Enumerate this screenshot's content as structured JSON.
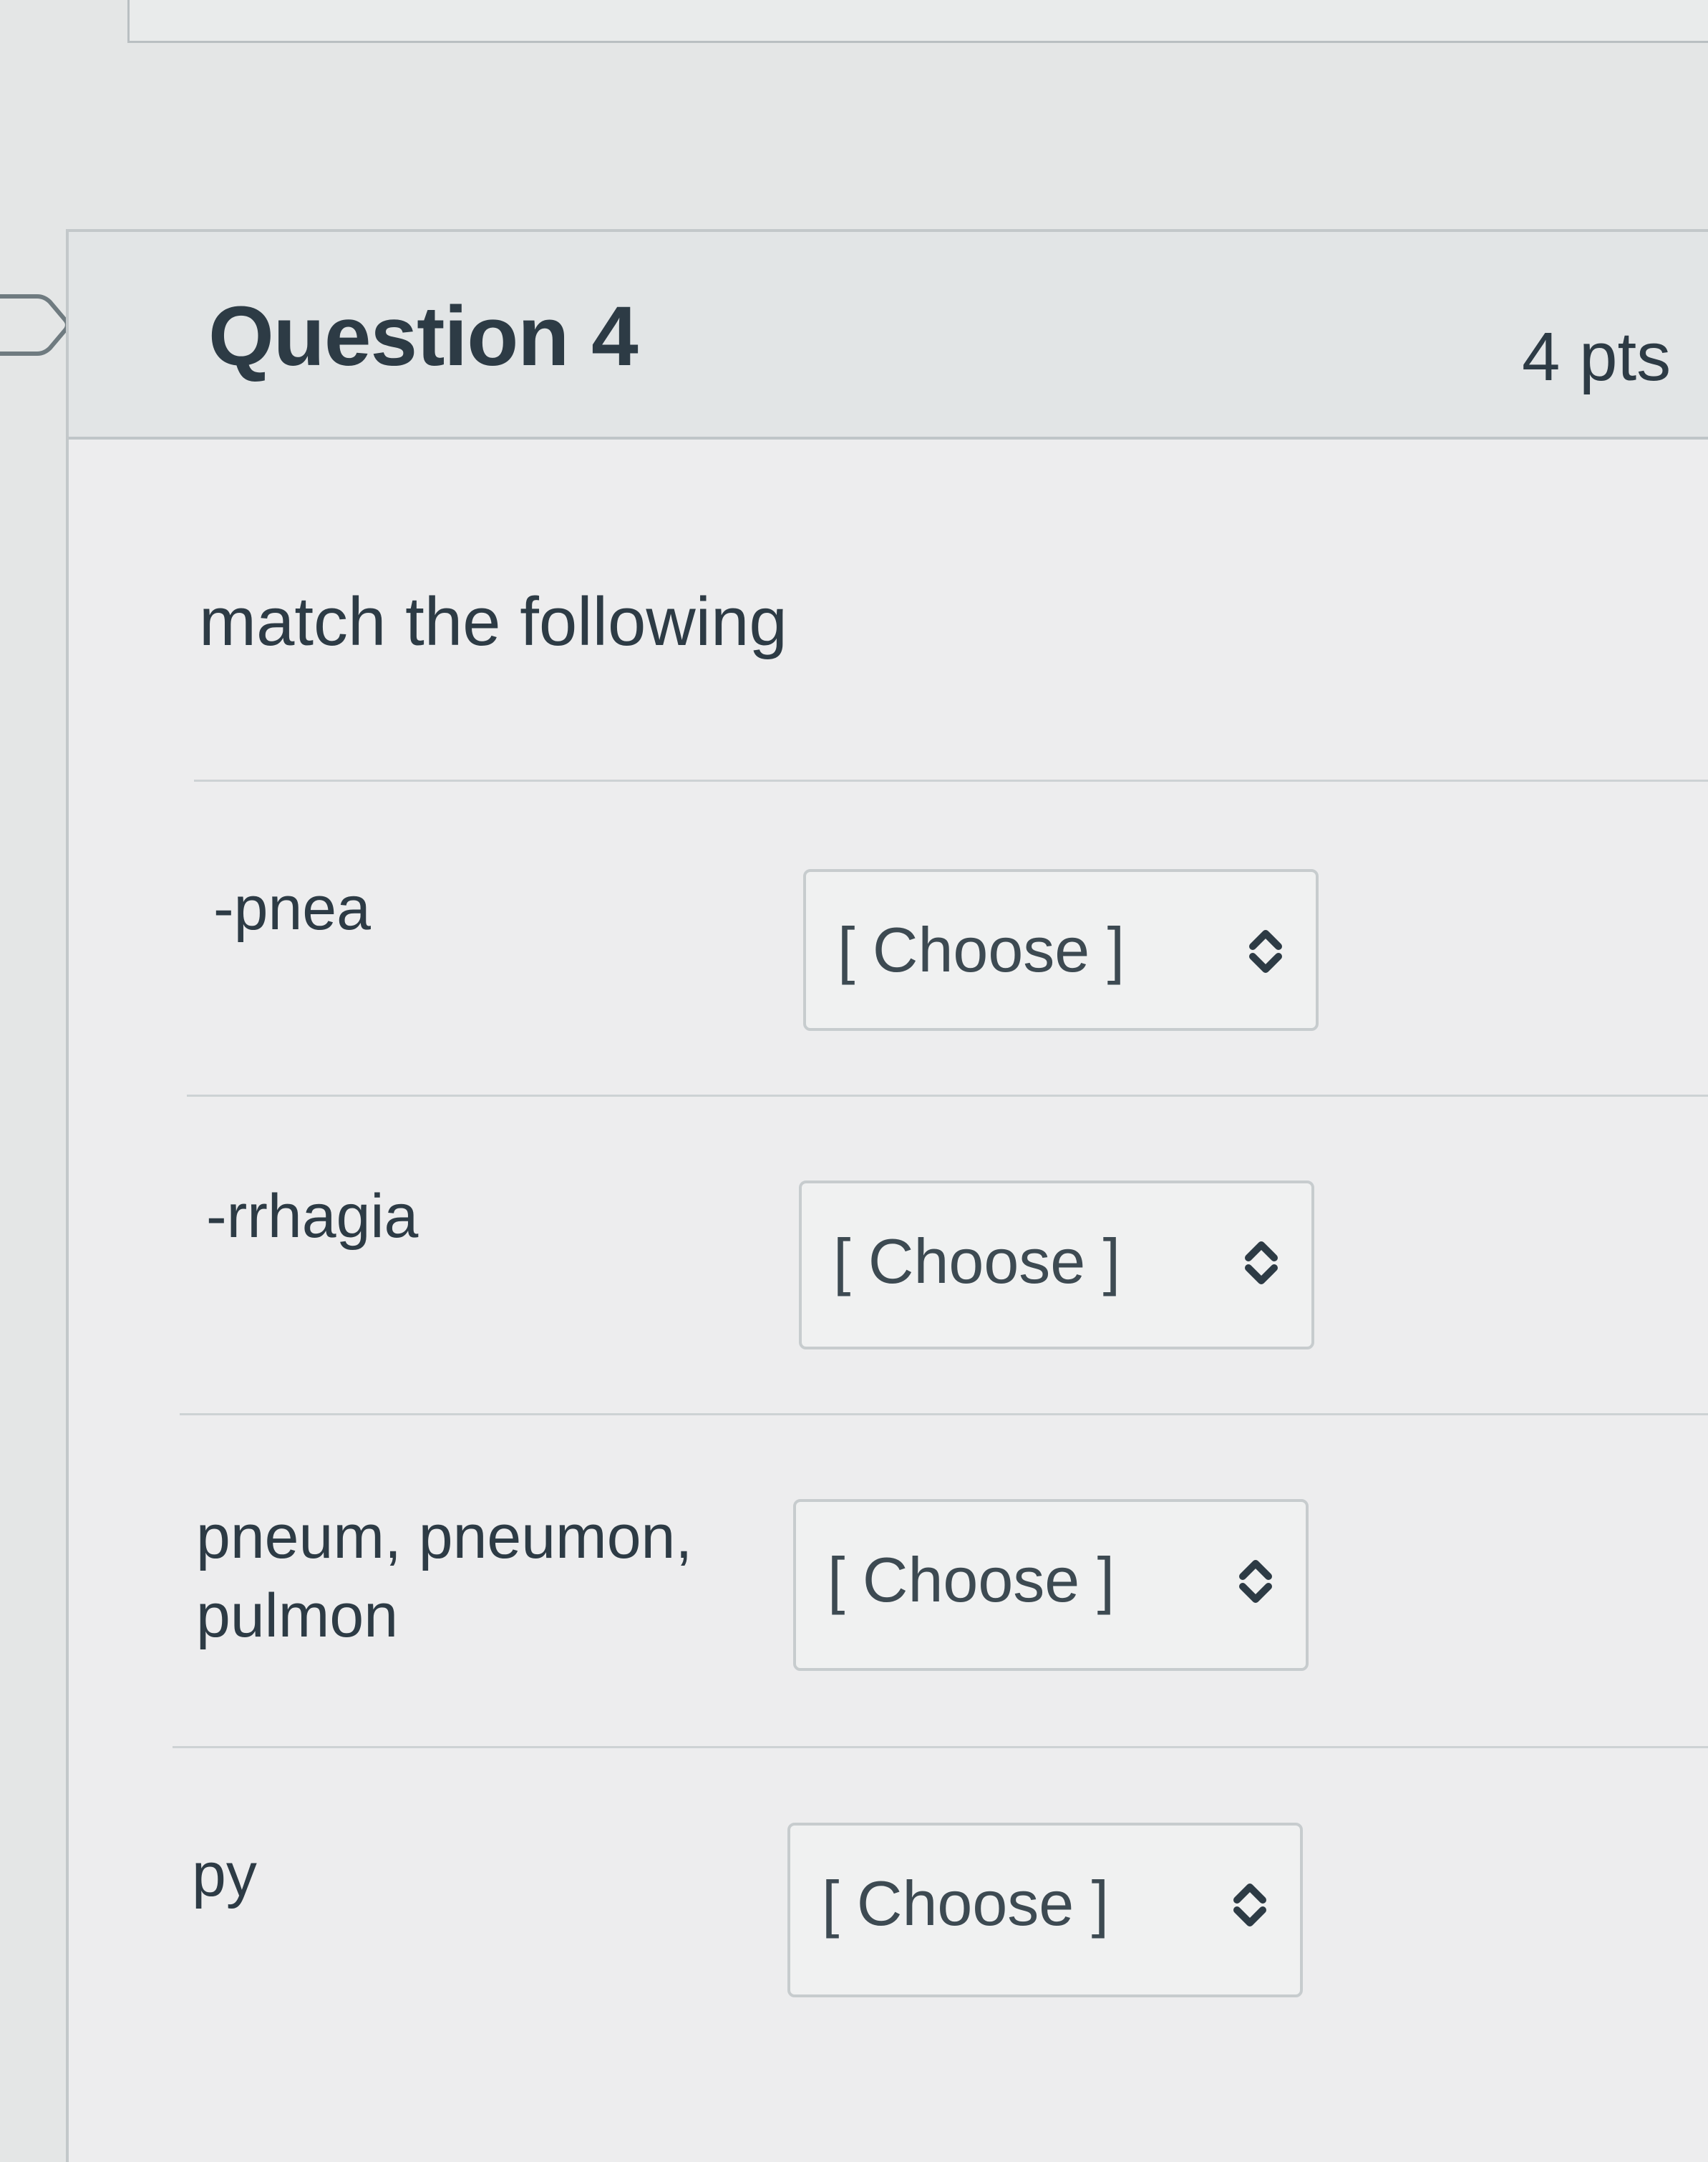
{
  "question": {
    "title": "Question 4",
    "points": "4 pts",
    "prompt": "match the following"
  },
  "matches": [
    {
      "label": "-pnea",
      "selected": "[ Choose ]"
    },
    {
      "label": "-rrhagia",
      "selected": "[ Choose ]"
    },
    {
      "label": "pneum, pneumon, pulmon",
      "selected": "[ Choose ]"
    },
    {
      "label": "py",
      "selected": "[ Choose ]"
    }
  ],
  "icons": {
    "flag": "question-flag-icon",
    "select_arrow": "up-down-chevron-icon"
  }
}
